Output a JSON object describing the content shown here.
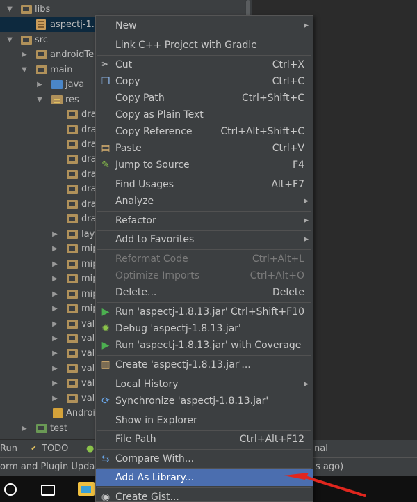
{
  "tree": {
    "rows": [
      {
        "label": "libs",
        "icon": "folder"
      },
      {
        "label": "aspectj-1.8",
        "icon": "jar"
      },
      {
        "label": "src",
        "icon": "folder"
      },
      {
        "label": "androidTe",
        "icon": "folder"
      },
      {
        "label": "main",
        "icon": "folder"
      },
      {
        "label": "java",
        "icon": "folder-blue"
      },
      {
        "label": "res",
        "icon": "folder-res"
      },
      {
        "label": "dra"
      },
      {
        "label": "dra"
      },
      {
        "label": "dra"
      },
      {
        "label": "dra"
      },
      {
        "label": "dra"
      },
      {
        "label": "dra"
      },
      {
        "label": "dra"
      },
      {
        "label": "dra"
      },
      {
        "label": "layo"
      },
      {
        "label": "mip"
      },
      {
        "label": "mip"
      },
      {
        "label": "mip"
      },
      {
        "label": "mip"
      },
      {
        "label": "mip"
      },
      {
        "label": "valu"
      },
      {
        "label": "valu"
      },
      {
        "label": "valu"
      },
      {
        "label": "valu"
      },
      {
        "label": "valu"
      },
      {
        "label": "valu"
      },
      {
        "label": "Androi"
      },
      {
        "label": "test"
      }
    ]
  },
  "bottom_tabs": {
    "run": "Run",
    "todo": "TODO",
    "terminal_tail": "nal"
  },
  "status": {
    "left": "orm and Plugin Updat",
    "right": "s ago)"
  },
  "menu": {
    "items": [
      {
        "label": "New",
        "submenu": true
      },
      {
        "label": "Link C++ Project with Gradle"
      },
      {
        "label": "Cut",
        "shortcut": "Ctrl+X",
        "icon": "cut-icon"
      },
      {
        "label": "Copy",
        "shortcut": "Ctrl+C",
        "icon": "copy-icon"
      },
      {
        "label": "Copy Path",
        "shortcut": "Ctrl+Shift+C"
      },
      {
        "label": "Copy as Plain Text"
      },
      {
        "label": "Copy Reference",
        "shortcut": "Ctrl+Alt+Shift+C"
      },
      {
        "label": "Paste",
        "shortcut": "Ctrl+V",
        "icon": "paste-icon"
      },
      {
        "label": "Jump to Source",
        "shortcut": "F4",
        "icon": "jump-to-source-icon"
      },
      {
        "label": "Find Usages",
        "shortcut": "Alt+F7"
      },
      {
        "label": "Analyze",
        "submenu": true
      },
      {
        "label": "Refactor",
        "submenu": true
      },
      {
        "label": "Add to Favorites",
        "submenu": true
      },
      {
        "label": "Reformat Code",
        "shortcut": "Ctrl+Alt+L",
        "disabled": true
      },
      {
        "label": "Optimize Imports",
        "shortcut": "Ctrl+Alt+O",
        "disabled": true
      },
      {
        "label": "Delete...",
        "shortcut": "Delete"
      },
      {
        "label": "Run 'aspectj-1.8.13.jar'",
        "shortcut": "Ctrl+Shift+F10",
        "icon": "run-icon"
      },
      {
        "label": "Debug 'aspectj-1.8.13.jar'",
        "icon": "debug-icon"
      },
      {
        "label": "Run 'aspectj-1.8.13.jar' with Coverage",
        "icon": "coverage-icon"
      },
      {
        "label": "Create 'aspectj-1.8.13.jar'...",
        "icon": "create-config-icon"
      },
      {
        "label": "Local History",
        "submenu": true
      },
      {
        "label": "Synchronize 'aspectj-1.8.13.jar'",
        "icon": "sync-icon"
      },
      {
        "label": "Show in Explorer"
      },
      {
        "label": "File Path",
        "shortcut": "Ctrl+Alt+F12"
      },
      {
        "label": "Compare With...",
        "icon": "compare-icon"
      },
      {
        "label": "Add As Library...",
        "highlighted": true
      },
      {
        "label": "Create Gist...",
        "icon": "github-icon"
      }
    ]
  },
  "colors": {
    "menu_bg": "#3c3f41",
    "highlight": "#4b6eaf",
    "arrow": "#e0261e",
    "run_green": "#4caf50"
  }
}
